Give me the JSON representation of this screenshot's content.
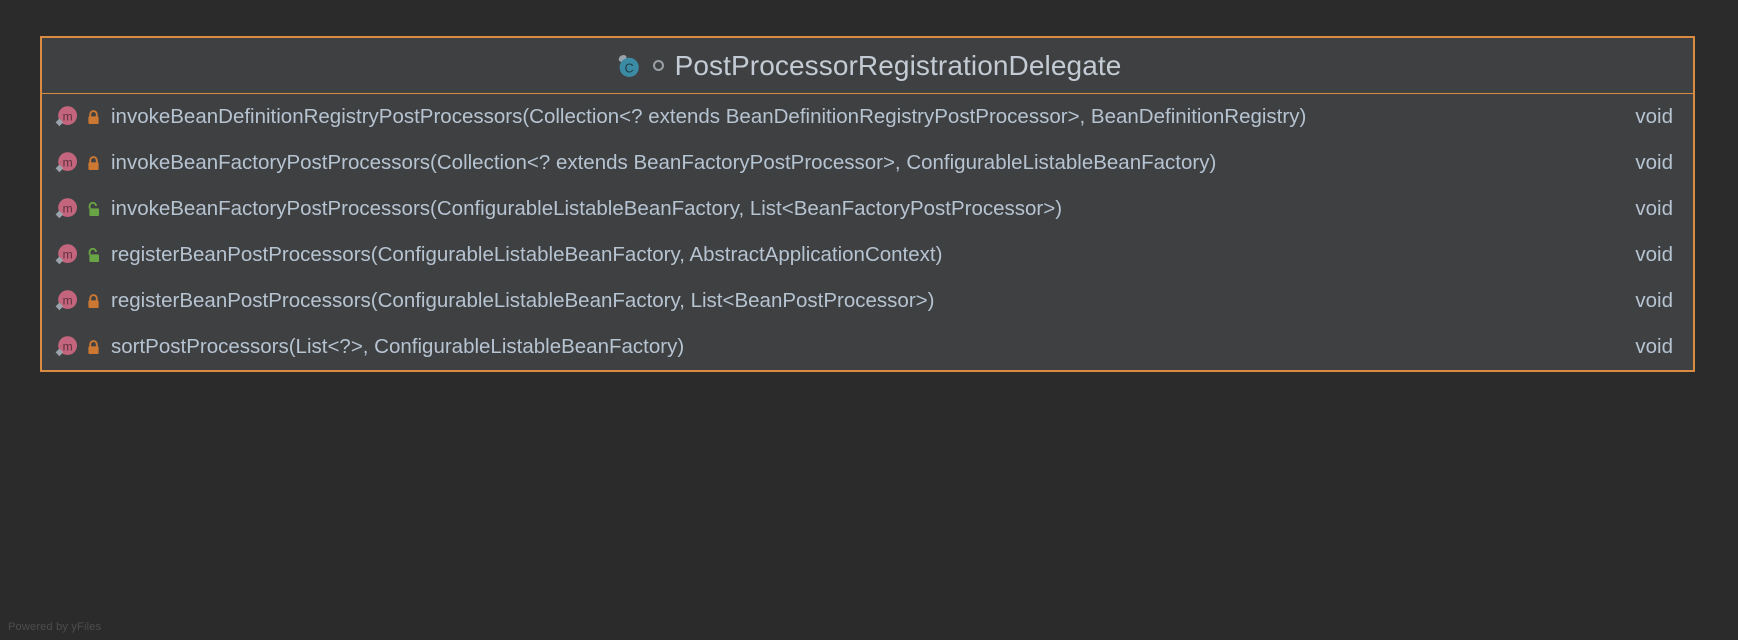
{
  "canvas": {
    "background_color": "#2b2b2b",
    "watermark": "Powered by yFiles"
  },
  "class_node": {
    "border_color": "#d98c41",
    "fill_color": "#3f4042",
    "text_color": "#b6c3d1",
    "header": {
      "icon": "class-icon",
      "icon_letter": "C",
      "icon_color": "#3b8ba5",
      "marker": "circle-outline-icon",
      "title": "PostProcessorRegistrationDelegate"
    },
    "members": [
      {
        "kind_icon": "method-icon",
        "kind_letter": "m",
        "visibility_icon": "lock-closed-icon",
        "visibility": "private",
        "visibility_color": "#cc7832",
        "static": true,
        "signature": "invokeBeanDefinitionRegistryPostProcessors(Collection<? extends BeanDefinitionRegistryPostProcessor>, BeanDefinitionRegistry)",
        "return_type": "void"
      },
      {
        "kind_icon": "method-icon",
        "kind_letter": "m",
        "visibility_icon": "lock-closed-icon",
        "visibility": "private",
        "visibility_color": "#cc7832",
        "static": true,
        "signature": "invokeBeanFactoryPostProcessors(Collection<? extends BeanFactoryPostProcessor>, ConfigurableListableBeanFactory)",
        "return_type": "void"
      },
      {
        "kind_icon": "method-icon",
        "kind_letter": "m",
        "visibility_icon": "lock-open-icon",
        "visibility": "public",
        "visibility_color": "#69a544",
        "static": true,
        "signature": "invokeBeanFactoryPostProcessors(ConfigurableListableBeanFactory, List<BeanFactoryPostProcessor>)",
        "return_type": "void"
      },
      {
        "kind_icon": "method-icon",
        "kind_letter": "m",
        "visibility_icon": "lock-open-icon",
        "visibility": "public",
        "visibility_color": "#69a544",
        "static": true,
        "signature": "registerBeanPostProcessors(ConfigurableListableBeanFactory, AbstractApplicationContext)",
        "return_type": "void"
      },
      {
        "kind_icon": "method-icon",
        "kind_letter": "m",
        "visibility_icon": "lock-closed-icon",
        "visibility": "private",
        "visibility_color": "#cc7832",
        "static": true,
        "signature": "registerBeanPostProcessors(ConfigurableListableBeanFactory, List<BeanPostProcessor>)",
        "return_type": "void"
      },
      {
        "kind_icon": "method-icon",
        "kind_letter": "m",
        "visibility_icon": "lock-closed-icon",
        "visibility": "private",
        "visibility_color": "#cc7832",
        "static": true,
        "signature": "sortPostProcessors(List<?>, ConfigurableListableBeanFactory)",
        "return_type": "void"
      }
    ]
  }
}
